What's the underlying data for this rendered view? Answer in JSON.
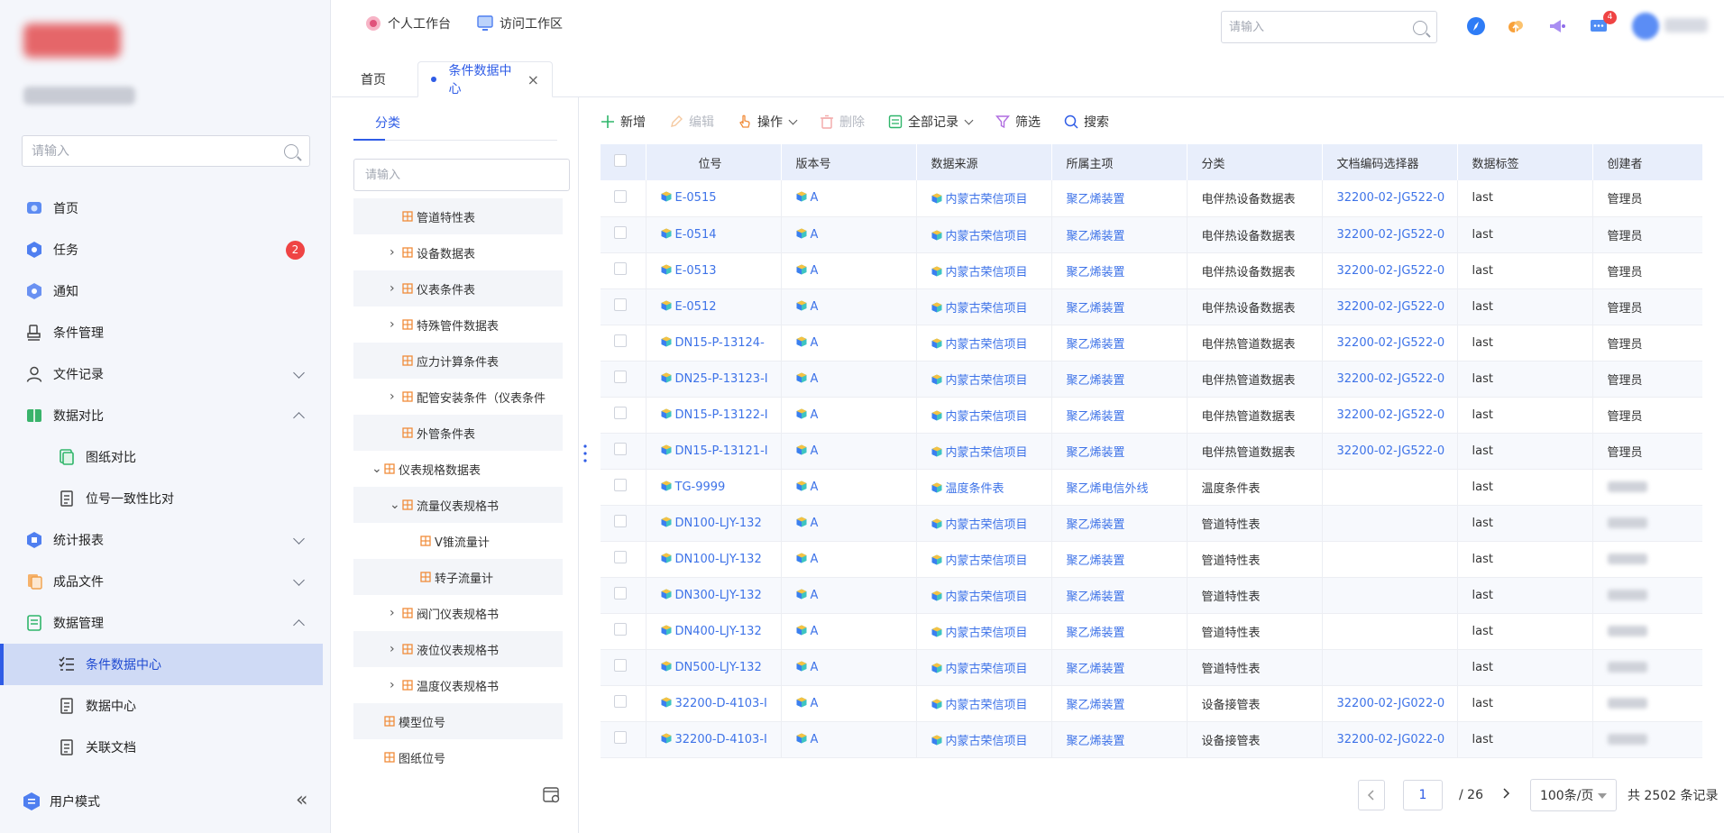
{
  "sidebar": {
    "search_placeholder": "请输入",
    "items": [
      {
        "label": "首页"
      },
      {
        "label": "任务",
        "badge": "2"
      },
      {
        "label": "通知"
      },
      {
        "label": "条件管理"
      },
      {
        "label": "文件记录"
      },
      {
        "label": "数据对比"
      },
      {
        "label": "图纸对比"
      },
      {
        "label": "位号一致性比对"
      },
      {
        "label": "统计报表"
      },
      {
        "label": "成品文件"
      },
      {
        "label": "数据管理"
      },
      {
        "label": "条件数据中心"
      },
      {
        "label": "数据中心"
      },
      {
        "label": "关联文档"
      }
    ],
    "bottom_label": "用户模式"
  },
  "topbar": {
    "personal_workspace": "个人工作台",
    "visit_workspace": "访问工作区",
    "search_placeholder": "请输入",
    "notification_count": "4"
  },
  "tabs": [
    {
      "label": "首页"
    },
    {
      "label": "条件数据中心"
    }
  ],
  "tree": {
    "tab_label": "分类",
    "search_placeholder": "请输入",
    "nodes": [
      {
        "label": "管道特性表"
      },
      {
        "label": "设备数据表"
      },
      {
        "label": "仪表条件表"
      },
      {
        "label": "特殊管件数据表"
      },
      {
        "label": "应力计算条件表"
      },
      {
        "label": "配管安装条件（仪表条件"
      },
      {
        "label": "外管条件表"
      },
      {
        "label": "仪表规格数据表"
      },
      {
        "label": "流量仪表规格书"
      },
      {
        "label": "V锥流量计"
      },
      {
        "label": "转子流量计"
      },
      {
        "label": "阀门仪表规格书"
      },
      {
        "label": "液位仪表规格书"
      },
      {
        "label": "温度仪表规格书"
      },
      {
        "label": "模型位号"
      },
      {
        "label": "图纸位号"
      }
    ]
  },
  "toolbar": {
    "add": "新增",
    "edit": "编辑",
    "operate": "操作",
    "delete": "删除",
    "all_records": "全部记录",
    "filter": "筛选",
    "search": "搜索"
  },
  "table": {
    "columns": [
      "位号",
      "版本号",
      "数据来源",
      "所属主项",
      "分类",
      "文档编码选择器",
      "数据标签",
      "创建者"
    ],
    "rows": [
      [
        "E-0515",
        "A",
        "内蒙古荣信项目",
        "聚乙烯装置",
        "电伴热设备数据表",
        "32200-02-JG522-0",
        "last",
        "管理员"
      ],
      [
        "E-0514",
        "A",
        "内蒙古荣信项目",
        "聚乙烯装置",
        "电伴热设备数据表",
        "32200-02-JG522-0",
        "last",
        "管理员"
      ],
      [
        "E-0513",
        "A",
        "内蒙古荣信项目",
        "聚乙烯装置",
        "电伴热设备数据表",
        "32200-02-JG522-0",
        "last",
        "管理员"
      ],
      [
        "E-0512",
        "A",
        "内蒙古荣信项目",
        "聚乙烯装置",
        "电伴热设备数据表",
        "32200-02-JG522-0",
        "last",
        "管理员"
      ],
      [
        "DN15-P-13124-",
        "A",
        "内蒙古荣信项目",
        "聚乙烯装置",
        "电伴热管道数据表",
        "32200-02-JG522-0",
        "last",
        "管理员"
      ],
      [
        "DN25-P-13123-I",
        "A",
        "内蒙古荣信项目",
        "聚乙烯装置",
        "电伴热管道数据表",
        "32200-02-JG522-0",
        "last",
        "管理员"
      ],
      [
        "DN15-P-13122-I",
        "A",
        "内蒙古荣信项目",
        "聚乙烯装置",
        "电伴热管道数据表",
        "32200-02-JG522-0",
        "last",
        "管理员"
      ],
      [
        "DN15-P-13121-I",
        "A",
        "内蒙古荣信项目",
        "聚乙烯装置",
        "电伴热管道数据表",
        "32200-02-JG522-0",
        "last",
        "管理员"
      ],
      [
        "TG-9999",
        "A",
        "温度条件表",
        "聚乙烯电信外线",
        "温度条件表",
        "",
        "last",
        ""
      ],
      [
        "DN100-LJY-132",
        "A",
        "内蒙古荣信项目",
        "聚乙烯装置",
        "管道特性表",
        "",
        "last",
        ""
      ],
      [
        "DN100-LJY-132",
        "A",
        "内蒙古荣信项目",
        "聚乙烯装置",
        "管道特性表",
        "",
        "last",
        ""
      ],
      [
        "DN300-LJY-132",
        "A",
        "内蒙古荣信项目",
        "聚乙烯装置",
        "管道特性表",
        "",
        "last",
        ""
      ],
      [
        "DN400-LJY-132",
        "A",
        "内蒙古荣信项目",
        "聚乙烯装置",
        "管道特性表",
        "",
        "last",
        ""
      ],
      [
        "DN500-LJY-132",
        "A",
        "内蒙古荣信项目",
        "聚乙烯装置",
        "管道特性表",
        "",
        "last",
        ""
      ],
      [
        "32200-D-4103-I",
        "A",
        "内蒙古荣信项目",
        "聚乙烯装置",
        "设备接管表",
        "32200-02-JG022-0",
        "last",
        ""
      ],
      [
        "32200-D-4103-I",
        "A",
        "内蒙古荣信项目",
        "聚乙烯装置",
        "设备接管表",
        "32200-02-JG022-0",
        "last",
        ""
      ]
    ]
  },
  "pagination": {
    "current_page": "1",
    "total_pages": "/ 26",
    "page_size": "100条/页",
    "total": "共 2502 条记录"
  }
}
